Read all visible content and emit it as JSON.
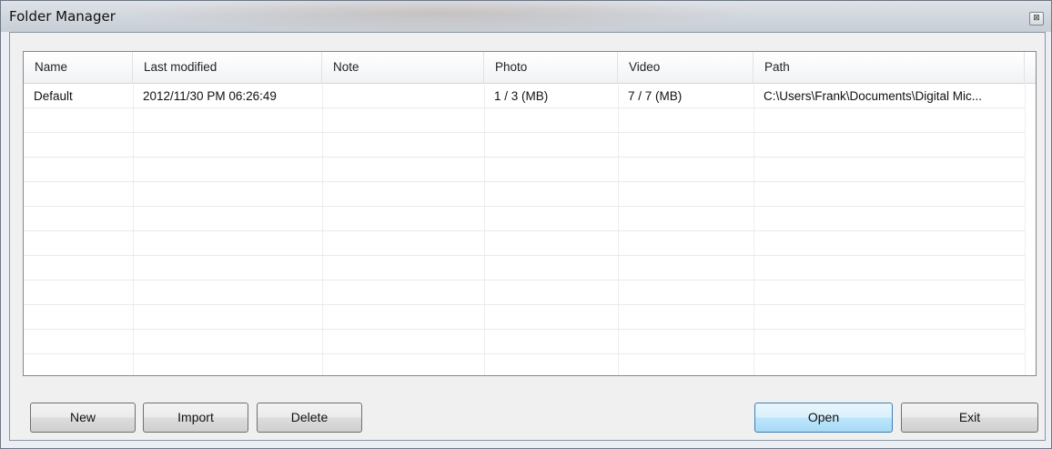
{
  "window": {
    "title": "Folder Manager",
    "close_glyph": "⊠"
  },
  "columns": [
    {
      "label": "Name"
    },
    {
      "label": "Last modified"
    },
    {
      "label": "Note"
    },
    {
      "label": "Photo"
    },
    {
      "label": "Video"
    },
    {
      "label": "Path"
    }
  ],
  "rows": [
    {
      "name": "Default",
      "last_modified": "2012/11/30 PM 06:26:49",
      "note": "",
      "photo": "1 / 3 (MB)",
      "video": "7 / 7 (MB)",
      "path": "C:\\Users\\Frank\\Documents\\Digital Mic..."
    }
  ],
  "buttons": {
    "new": "New",
    "import": "Import",
    "delete": "Delete",
    "open": "Open",
    "exit": "Exit"
  },
  "colors": {
    "default_button": "#bee6fd",
    "frame": "#6d7886"
  }
}
